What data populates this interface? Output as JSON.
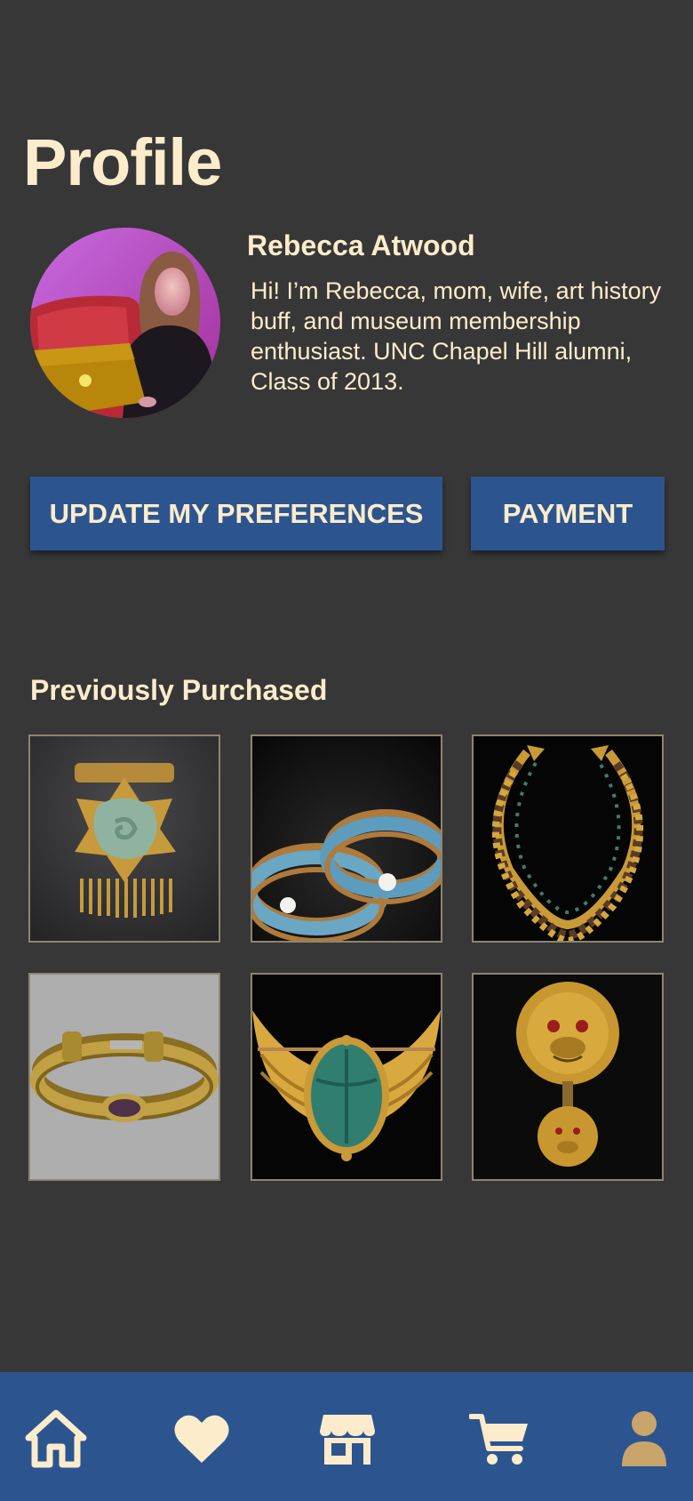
{
  "page": {
    "title": "Profile"
  },
  "profile": {
    "name": "Rebecca Atwood",
    "bio": "Hi! I’m Rebecca, mom, wife, art history buff, and museum membership enthusiast. UNC Chapel Hill alumni, Class of 2013.",
    "avatar_icon": "profile-photo"
  },
  "actions": {
    "preferences_label": "UPDATE MY PREFERENCES",
    "payment_label": "PAYMENT"
  },
  "purchases": {
    "title": "Previously Purchased",
    "items": [
      {
        "icon": "jade-brooch-image"
      },
      {
        "icon": "enamel-bangles-image"
      },
      {
        "icon": "gold-collar-necklace-image"
      },
      {
        "icon": "gold-cuff-bracelet-image"
      },
      {
        "icon": "winged-scarab-brooch-image"
      },
      {
        "icon": "lion-head-pendant-image"
      }
    ]
  },
  "nav": {
    "items": [
      {
        "icon": "home-icon",
        "active": false
      },
      {
        "icon": "heart-icon",
        "active": false
      },
      {
        "icon": "store-icon",
        "active": false
      },
      {
        "icon": "cart-icon",
        "active": false
      },
      {
        "icon": "user-icon",
        "active": true
      }
    ]
  },
  "colors": {
    "background": "#373737",
    "accent_blue": "#2c5590",
    "cream_text": "#fdeccb",
    "active_nav": "#c9a46b"
  }
}
